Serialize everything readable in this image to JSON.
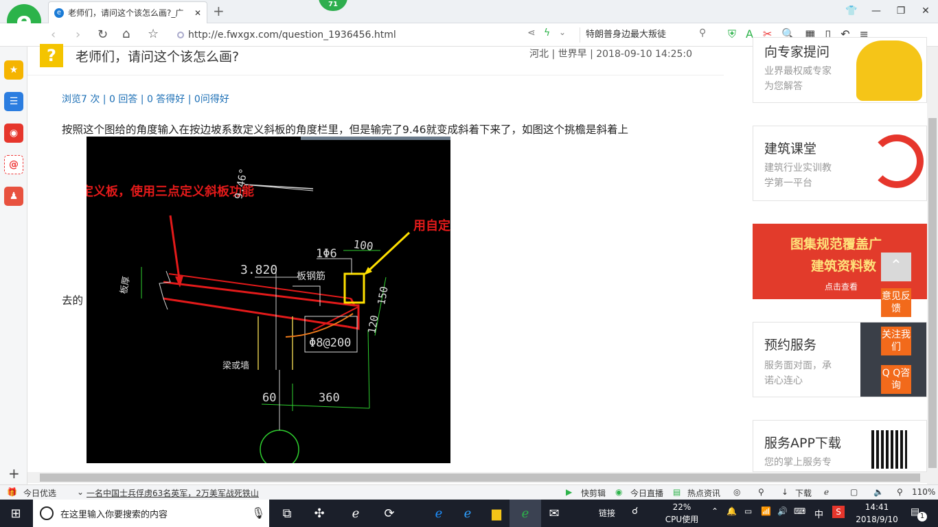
{
  "browser": {
    "tab_title": "老师们，请问这个该怎么画?_广",
    "tab_badge": "71",
    "url": "http://e.fwxgx.com/question_1936456.html",
    "search_value": "特朗普身边最大叛徒",
    "zoom": "110%"
  },
  "question": {
    "title": "老师们，请问这个该怎么画?",
    "meta": "河北 | 世界早 | 2018-09-10 14:25:0",
    "stats": "浏览7 次 | 0 回答 | 0 答得好 | 0问得好",
    "body_line1": "按照这个图给的角度输入在按边坡系数定义斜板的角度栏里，但是输完了9.46就变成斜着下来了，如图这个挑檐是斜着上",
    "body_line2": "去的"
  },
  "cad": {
    "annot_red": "定义板，使用三点定义斜板功能",
    "annot_red2": "用自定义线定义",
    "angle": "9.46°",
    "dim_100": "100",
    "elev": "3.820",
    "rebar1": "1Φ6",
    "rebar_label": "板钢筋",
    "dim_150": "150",
    "dim_120": "120",
    "rebar2": "Φ8@200",
    "beam_label": "梁或墙",
    "slab_label": "板厚",
    "dim_60": "60",
    "dim_360": "360"
  },
  "right": {
    "card1_title": "向专家提问",
    "card1_sub": [
      "业界最权威专家",
      "为您解答"
    ],
    "card2_title": "建筑课堂",
    "card2_sub": [
      "建筑行业实训教",
      "学第一平台"
    ],
    "card3_line1": "图集规范覆盖广",
    "card3_line2": "建筑资料数",
    "card3_link": "点击查看",
    "card4_title": "预约服务",
    "card4_sub": [
      "服务面对面，承",
      "诺心连心"
    ],
    "card5_title": "服务APP下载",
    "card5_sub": "您的掌上服务专"
  },
  "float": {
    "feedback": "意见反馈",
    "follow": "关注我们",
    "qq": "Q Q咨询"
  },
  "status": {
    "today": "今日优选",
    "news": "一名中国士兵俘虏63名英军，2万美军战死铁山",
    "clip": "快剪辑",
    "live": "今日直播",
    "hot": "热点资讯",
    "download": "下载"
  },
  "taskbar": {
    "search_placeholder": "在这里输入你要搜索的内容",
    "link": "链接",
    "cpu_pct": "22%",
    "cpu_label": "CPU使用",
    "lang": "中",
    "time": "14:41",
    "date": "2018/9/10",
    "notif": "1"
  }
}
